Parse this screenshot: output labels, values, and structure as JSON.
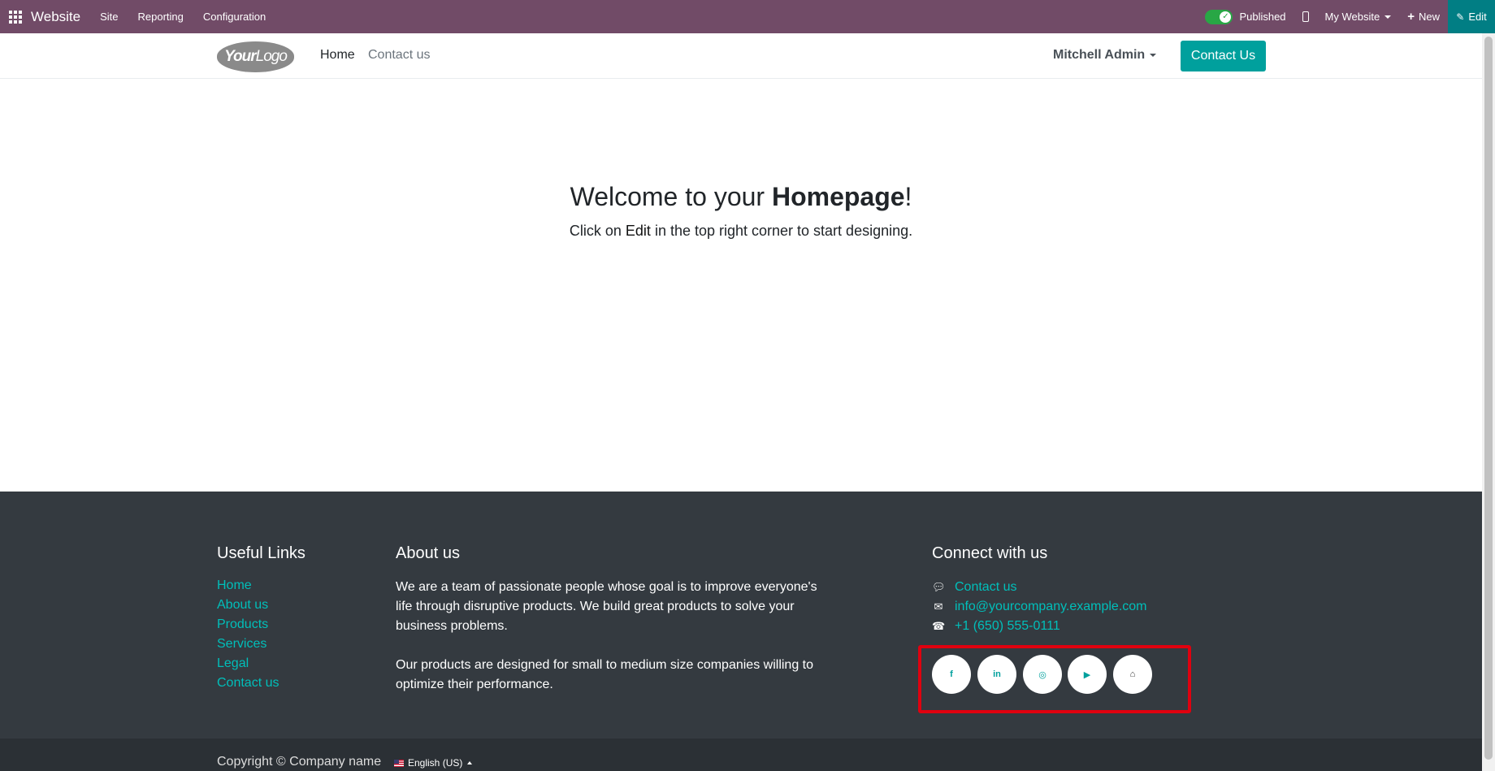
{
  "adminbar": {
    "brand": "Website",
    "menus": [
      "Site",
      "Reporting",
      "Configuration"
    ],
    "published_label": "Published",
    "my_website_label": "My Website",
    "new_label": "New",
    "edit_label": "Edit",
    "bar_color": "#714B67"
  },
  "header": {
    "logo_text_bold": "Your",
    "logo_text_light": "Logo",
    "nav": [
      "Home",
      "Contact us"
    ],
    "user": "Mitchell Admin",
    "cta": "Contact Us",
    "accent": "#00A09D"
  },
  "hero": {
    "title_pre": "Welcome to your ",
    "title_bold": "Homepage",
    "title_post": "!",
    "sub_pre": "Click on ",
    "sub_edit": "Edit",
    "sub_post": " in the top right corner to start designing."
  },
  "footer": {
    "useful_title": "Useful Links",
    "useful_links": [
      "Home",
      "About us",
      "Products",
      "Services",
      "Legal",
      "Contact us"
    ],
    "about_title": "About us",
    "about_p1": "We are a team of passionate people whose goal is to improve everyone's life through disruptive products. We build great products to solve your business problems.",
    "about_p2": "Our products are designed for small to medium size companies willing to optimize their performance.",
    "connect_title": "Connect with us",
    "connect": [
      {
        "icon": "comment-icon",
        "text": "Contact us"
      },
      {
        "icon": "envelope-icon",
        "text": "info@yourcompany.example.com"
      },
      {
        "icon": "phone-icon",
        "text": "+1 (650) 555-0111"
      }
    ],
    "social": [
      {
        "icon": "facebook-icon",
        "glyph": "f"
      },
      {
        "icon": "linkedin-icon",
        "glyph": "in"
      },
      {
        "icon": "instagram-icon",
        "glyph": "◎"
      },
      {
        "icon": "youtube-icon",
        "glyph": "▶"
      },
      {
        "icon": "home-icon",
        "glyph": "⌂"
      }
    ],
    "bg": "#343a40"
  },
  "copyright": {
    "text": "Copyright © Company name",
    "lang": "English (US)"
  }
}
